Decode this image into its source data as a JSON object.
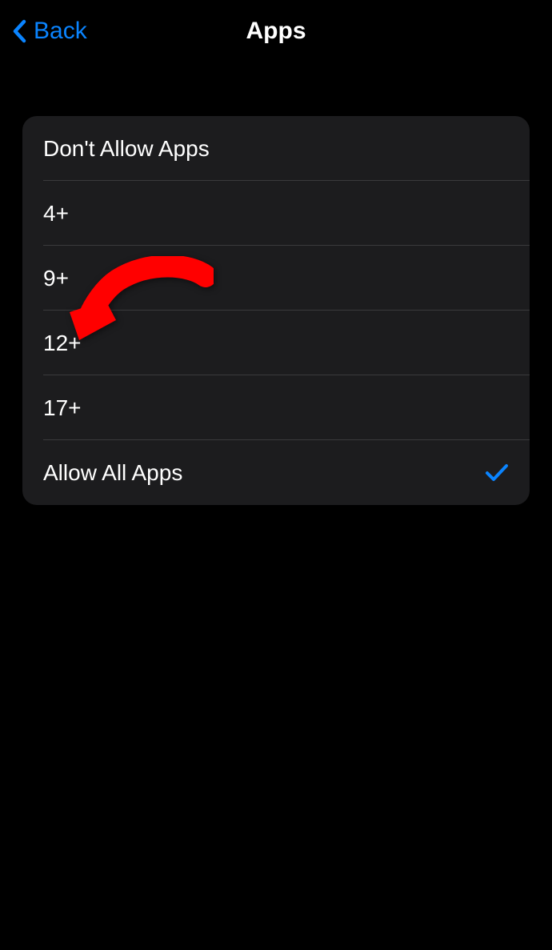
{
  "header": {
    "back_label": "Back",
    "title": "Apps"
  },
  "options": [
    {
      "label": "Don't Allow Apps",
      "selected": false
    },
    {
      "label": "4+",
      "selected": false
    },
    {
      "label": "9+",
      "selected": false
    },
    {
      "label": "12+",
      "selected": false
    },
    {
      "label": "17+",
      "selected": false
    },
    {
      "label": "Allow All Apps",
      "selected": true
    }
  ],
  "colors": {
    "accent": "#0a84ff",
    "annotation": "#ff0000"
  }
}
